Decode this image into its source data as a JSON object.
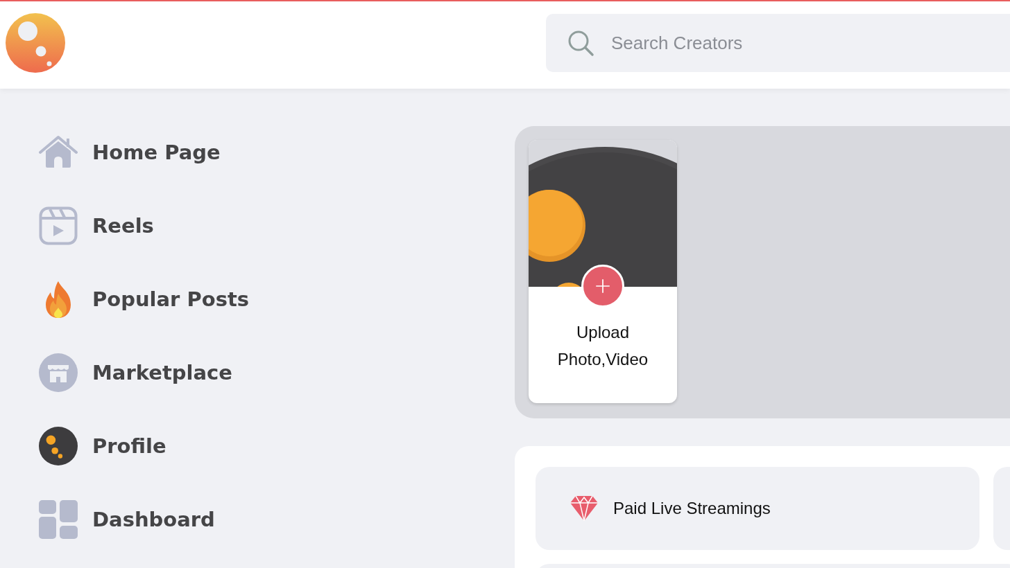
{
  "search": {
    "placeholder": "Search Creators"
  },
  "sidebar": {
    "items": [
      {
        "label": "Home Page"
      },
      {
        "label": "Reels"
      },
      {
        "label": "Popular Posts"
      },
      {
        "label": "Marketplace"
      },
      {
        "label": "Profile"
      },
      {
        "label": "Dashboard"
      }
    ]
  },
  "stories": {
    "upload_card": {
      "label": "Upload Photo,Video"
    }
  },
  "features": {
    "items": [
      {
        "label": "Paid Live Streamings"
      }
    ]
  }
}
